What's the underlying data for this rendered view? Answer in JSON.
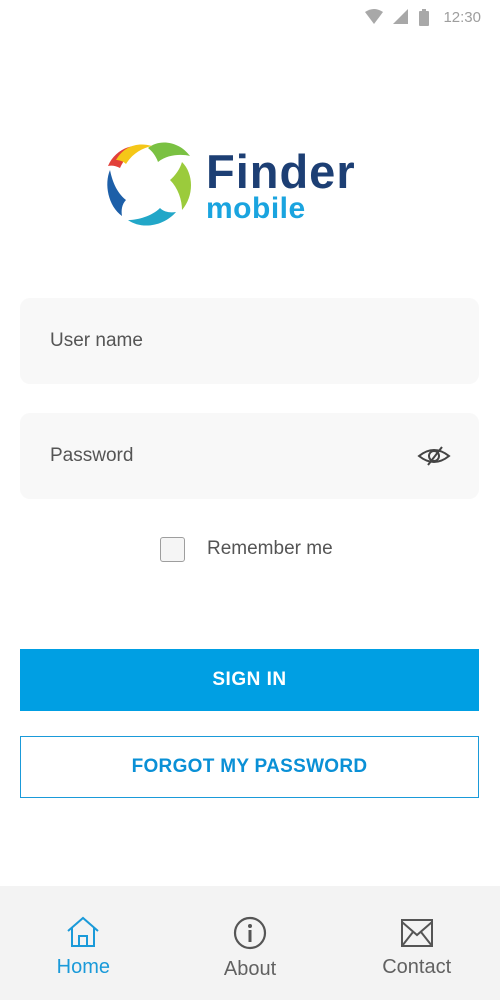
{
  "status_bar": {
    "time": "12:30",
    "icons": [
      "wifi-icon",
      "cellular-signal-icon",
      "battery-icon"
    ]
  },
  "logo": {
    "brand_word": "Finder",
    "sub_word": "mobile",
    "colors": {
      "brand": "#1d3f74",
      "sub": "#1aa4df"
    }
  },
  "login_form": {
    "username_placeholder": "User name",
    "password_placeholder": "Password",
    "password_toggle_icon": "eye-slash-icon",
    "remember_label": "Remember me",
    "remember_checked": false,
    "sign_in_label": "SIGN IN",
    "forgot_label": "FORGOT MY PASSWORD"
  },
  "bottom_nav": {
    "items": [
      {
        "label": "Home",
        "icon": "home-icon",
        "active": true
      },
      {
        "label": "About",
        "icon": "info-icon",
        "active": false
      },
      {
        "label": "Contact",
        "icon": "mail-icon",
        "active": false
      }
    ]
  },
  "colors": {
    "accent": "#009fe3",
    "field_background": "#f8f8f8",
    "nav_background": "#f3f3f3",
    "nav_inactive": "#616161"
  }
}
